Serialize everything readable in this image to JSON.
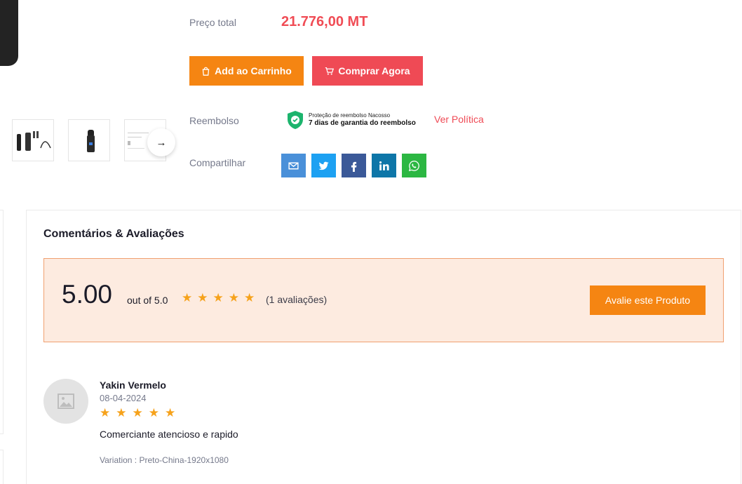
{
  "product": {
    "price_label": "Preço total",
    "price_value": "21.776,00 MT",
    "add_to_cart_label": "Add ao Carrinho",
    "buy_now_label": "Comprar Agora",
    "refund_label": "Reembolso",
    "refund_badge_line1": "Proteção de reembolso Nacosso",
    "refund_badge_line2": "7 dias de garantia do reembolso",
    "policy_link": "Ver Política",
    "share_label": "Compartilhar"
  },
  "share_icons": [
    "email-icon",
    "twitter-icon",
    "facebook-icon",
    "linkedin-icon",
    "whatsapp-icon"
  ],
  "colors": {
    "accent_orange": "#f58512",
    "accent_red": "#ef4a55",
    "star": "#f6a21b",
    "rating_box_bg": "#fdebe0"
  },
  "reviews": {
    "title": "Comentários & Avaliações",
    "score": "5.00",
    "out_of": "out of 5.0",
    "stars": 5,
    "count_text": "(1 avaliações)",
    "rate_button": "Avalie este Produto",
    "items": [
      {
        "name": "Yakin Vermelo",
        "date": "08-04-2024",
        "stars": 5,
        "text": "Comerciante atencioso e rapido",
        "variation": "Variation : Preto-China-1920x1080"
      }
    ]
  }
}
